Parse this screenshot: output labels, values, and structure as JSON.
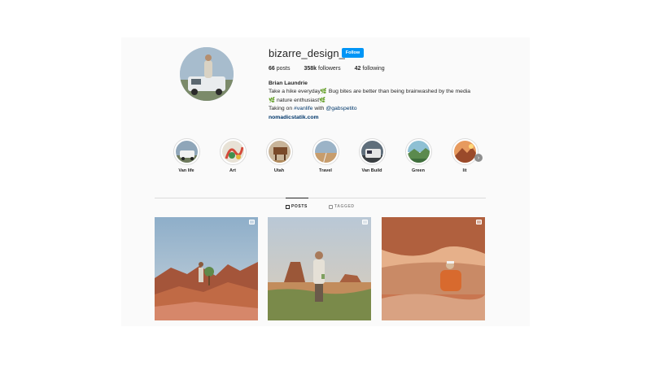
{
  "profile": {
    "username": "bizarre_design_",
    "follow_label": "Follow",
    "stats": {
      "posts_count": "66",
      "posts_label": "posts",
      "followers_count": "358k",
      "followers_label": "followers",
      "following_count": "42",
      "following_label": "following"
    },
    "full_name": "Brian Laundrie",
    "bio_line1": "Take a hike everyday",
    "bio_line1b": "Bug bites are better than being brainwashed by the media",
    "bio_line2": "nature enthusiast",
    "bio_line3_prefix": "Taking on",
    "bio_hashtag": "#vanlife",
    "bio_with": "with",
    "bio_mention": "@gabspetito",
    "website": "nomadicstatik.com",
    "leaf_glyph": "🌿"
  },
  "highlights": [
    {
      "label": "Van life"
    },
    {
      "label": "Art"
    },
    {
      "label": "Utah"
    },
    {
      "label": "Travel"
    },
    {
      "label": "Van Build"
    },
    {
      "label": "Green"
    },
    {
      "label": "lit"
    }
  ],
  "tabs": {
    "posts": "POSTS",
    "tagged": "TAGGED"
  },
  "colors": {
    "follow_button": "#0095f6",
    "link": "#00376b"
  },
  "icons": {
    "grid": "grid-icon",
    "tag": "tag-icon",
    "multiple": "multiple-posts-icon",
    "next": "chevron-right-icon"
  }
}
